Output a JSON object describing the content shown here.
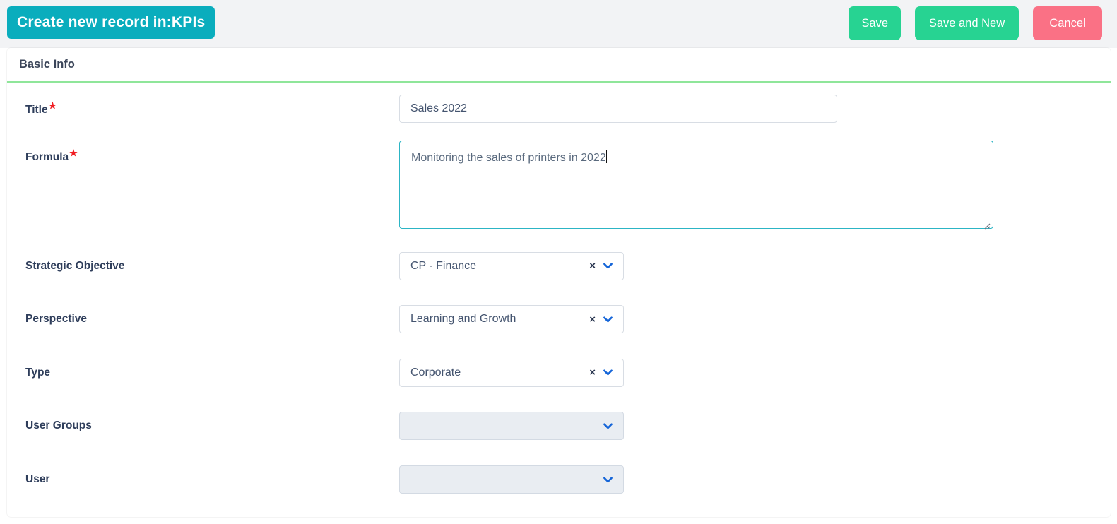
{
  "topbar": {
    "title_badge": "Create new record in:KPIs",
    "buttons": [
      {
        "label": "Save",
        "name": "save-button",
        "color": "#27d392"
      },
      {
        "label": "Save and New",
        "name": "save-and-new-button",
        "color": "#27d392"
      },
      {
        "label": "Cancel",
        "name": "cancel-button",
        "color": "#fa7185"
      }
    ]
  },
  "section": {
    "header": "Basic Info",
    "underline_color": "#8fe69a"
  },
  "fields": {
    "title": {
      "label": "Title",
      "required": true,
      "required_marker": "★",
      "value": "Sales 2022",
      "placeholder": ""
    },
    "formula": {
      "label": "Formula",
      "required": true,
      "required_marker": "★",
      "value": "Monitoring the sales of printers in 2022",
      "placeholder": "",
      "focused": true,
      "focus_border_color": "#2cb5c5"
    },
    "strategic_objective": {
      "label": "Strategic Objective",
      "required": false,
      "value": "CP - Finance",
      "has_clear": true,
      "clear_icon": "×",
      "chevron_icon": "chevron-down-icon"
    },
    "perspective": {
      "label": "Perspective",
      "required": false,
      "value": "Learning and Growth",
      "has_clear": true,
      "clear_icon": "×",
      "chevron_icon": "chevron-down-icon"
    },
    "type": {
      "label": "Type",
      "required": false,
      "value": "Corporate",
      "has_clear": true,
      "clear_icon": "×",
      "chevron_icon": "chevron-down-icon"
    },
    "user_groups": {
      "label": "User Groups",
      "required": false,
      "value": "",
      "has_clear": false,
      "chevron_icon": "chevron-down-icon"
    },
    "user": {
      "label": "User",
      "required": false,
      "value": "",
      "has_clear": false,
      "chevron_icon": "chevron-down-icon"
    }
  },
  "colors": {
    "badge_teal": "#0aadbd",
    "accent_green": "#27d392",
    "danger_pink": "#fa7185",
    "label_navy": "#2f3e5b",
    "chevron_blue": "#1565d8",
    "required_red": "#f01e23",
    "disabled_bg": "#e9edf2"
  }
}
